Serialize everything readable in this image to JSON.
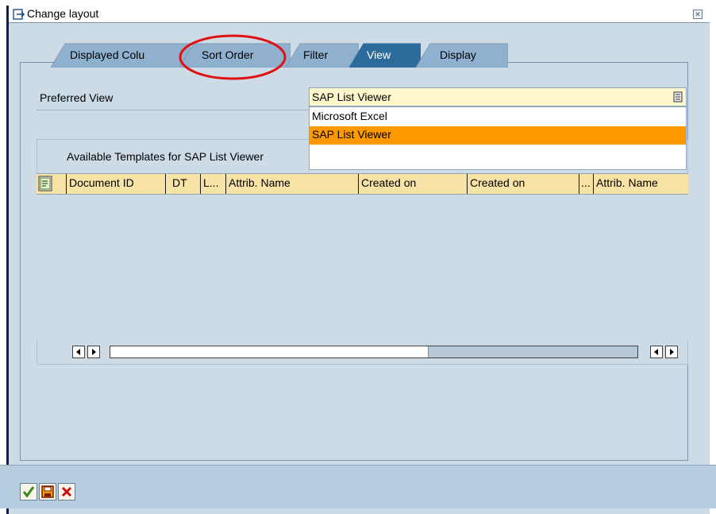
{
  "window": {
    "title": "Change layout",
    "close_icon": "close-icon"
  },
  "tabs": [
    {
      "label": "Displayed Colu"
    },
    {
      "label": "Sort Order"
    },
    {
      "label": "Filter"
    },
    {
      "label": "View",
      "active": true
    },
    {
      "label": "Display"
    }
  ],
  "preferred_view": {
    "label": "Preferred View",
    "selected": "SAP List Viewer",
    "dropdown_icon": "dropdown-list-icon",
    "options": [
      "Microsoft Excel",
      "SAP List Viewer"
    ],
    "highlighted_option": "SAP List Viewer"
  },
  "templates": {
    "title": "Available Templates for SAP List Viewer",
    "grid_menu_icon": "grid-details-icon",
    "columns": [
      "Document ID",
      "DT",
      "L...",
      "Attrib. Name",
      "Created on",
      "Created on",
      "...",
      "Attrib. Name"
    ],
    "rows": []
  },
  "scrollbar": {
    "left_icon": "scroll-left-icon",
    "right_icon": "scroll-right-icon"
  },
  "footer": {
    "buttons": [
      {
        "icon": "checkmark-icon"
      },
      {
        "icon": "save-icon"
      },
      {
        "icon": "cancel-icon"
      }
    ]
  },
  "colors": {
    "panel_bg": "#ccdbe6",
    "active_tab": "#2d6b9a",
    "inactive_tab": "#8fb1cf",
    "header_bg": "#f6e3a5",
    "selection": "#ff9900",
    "annotation": "#e01010"
  }
}
